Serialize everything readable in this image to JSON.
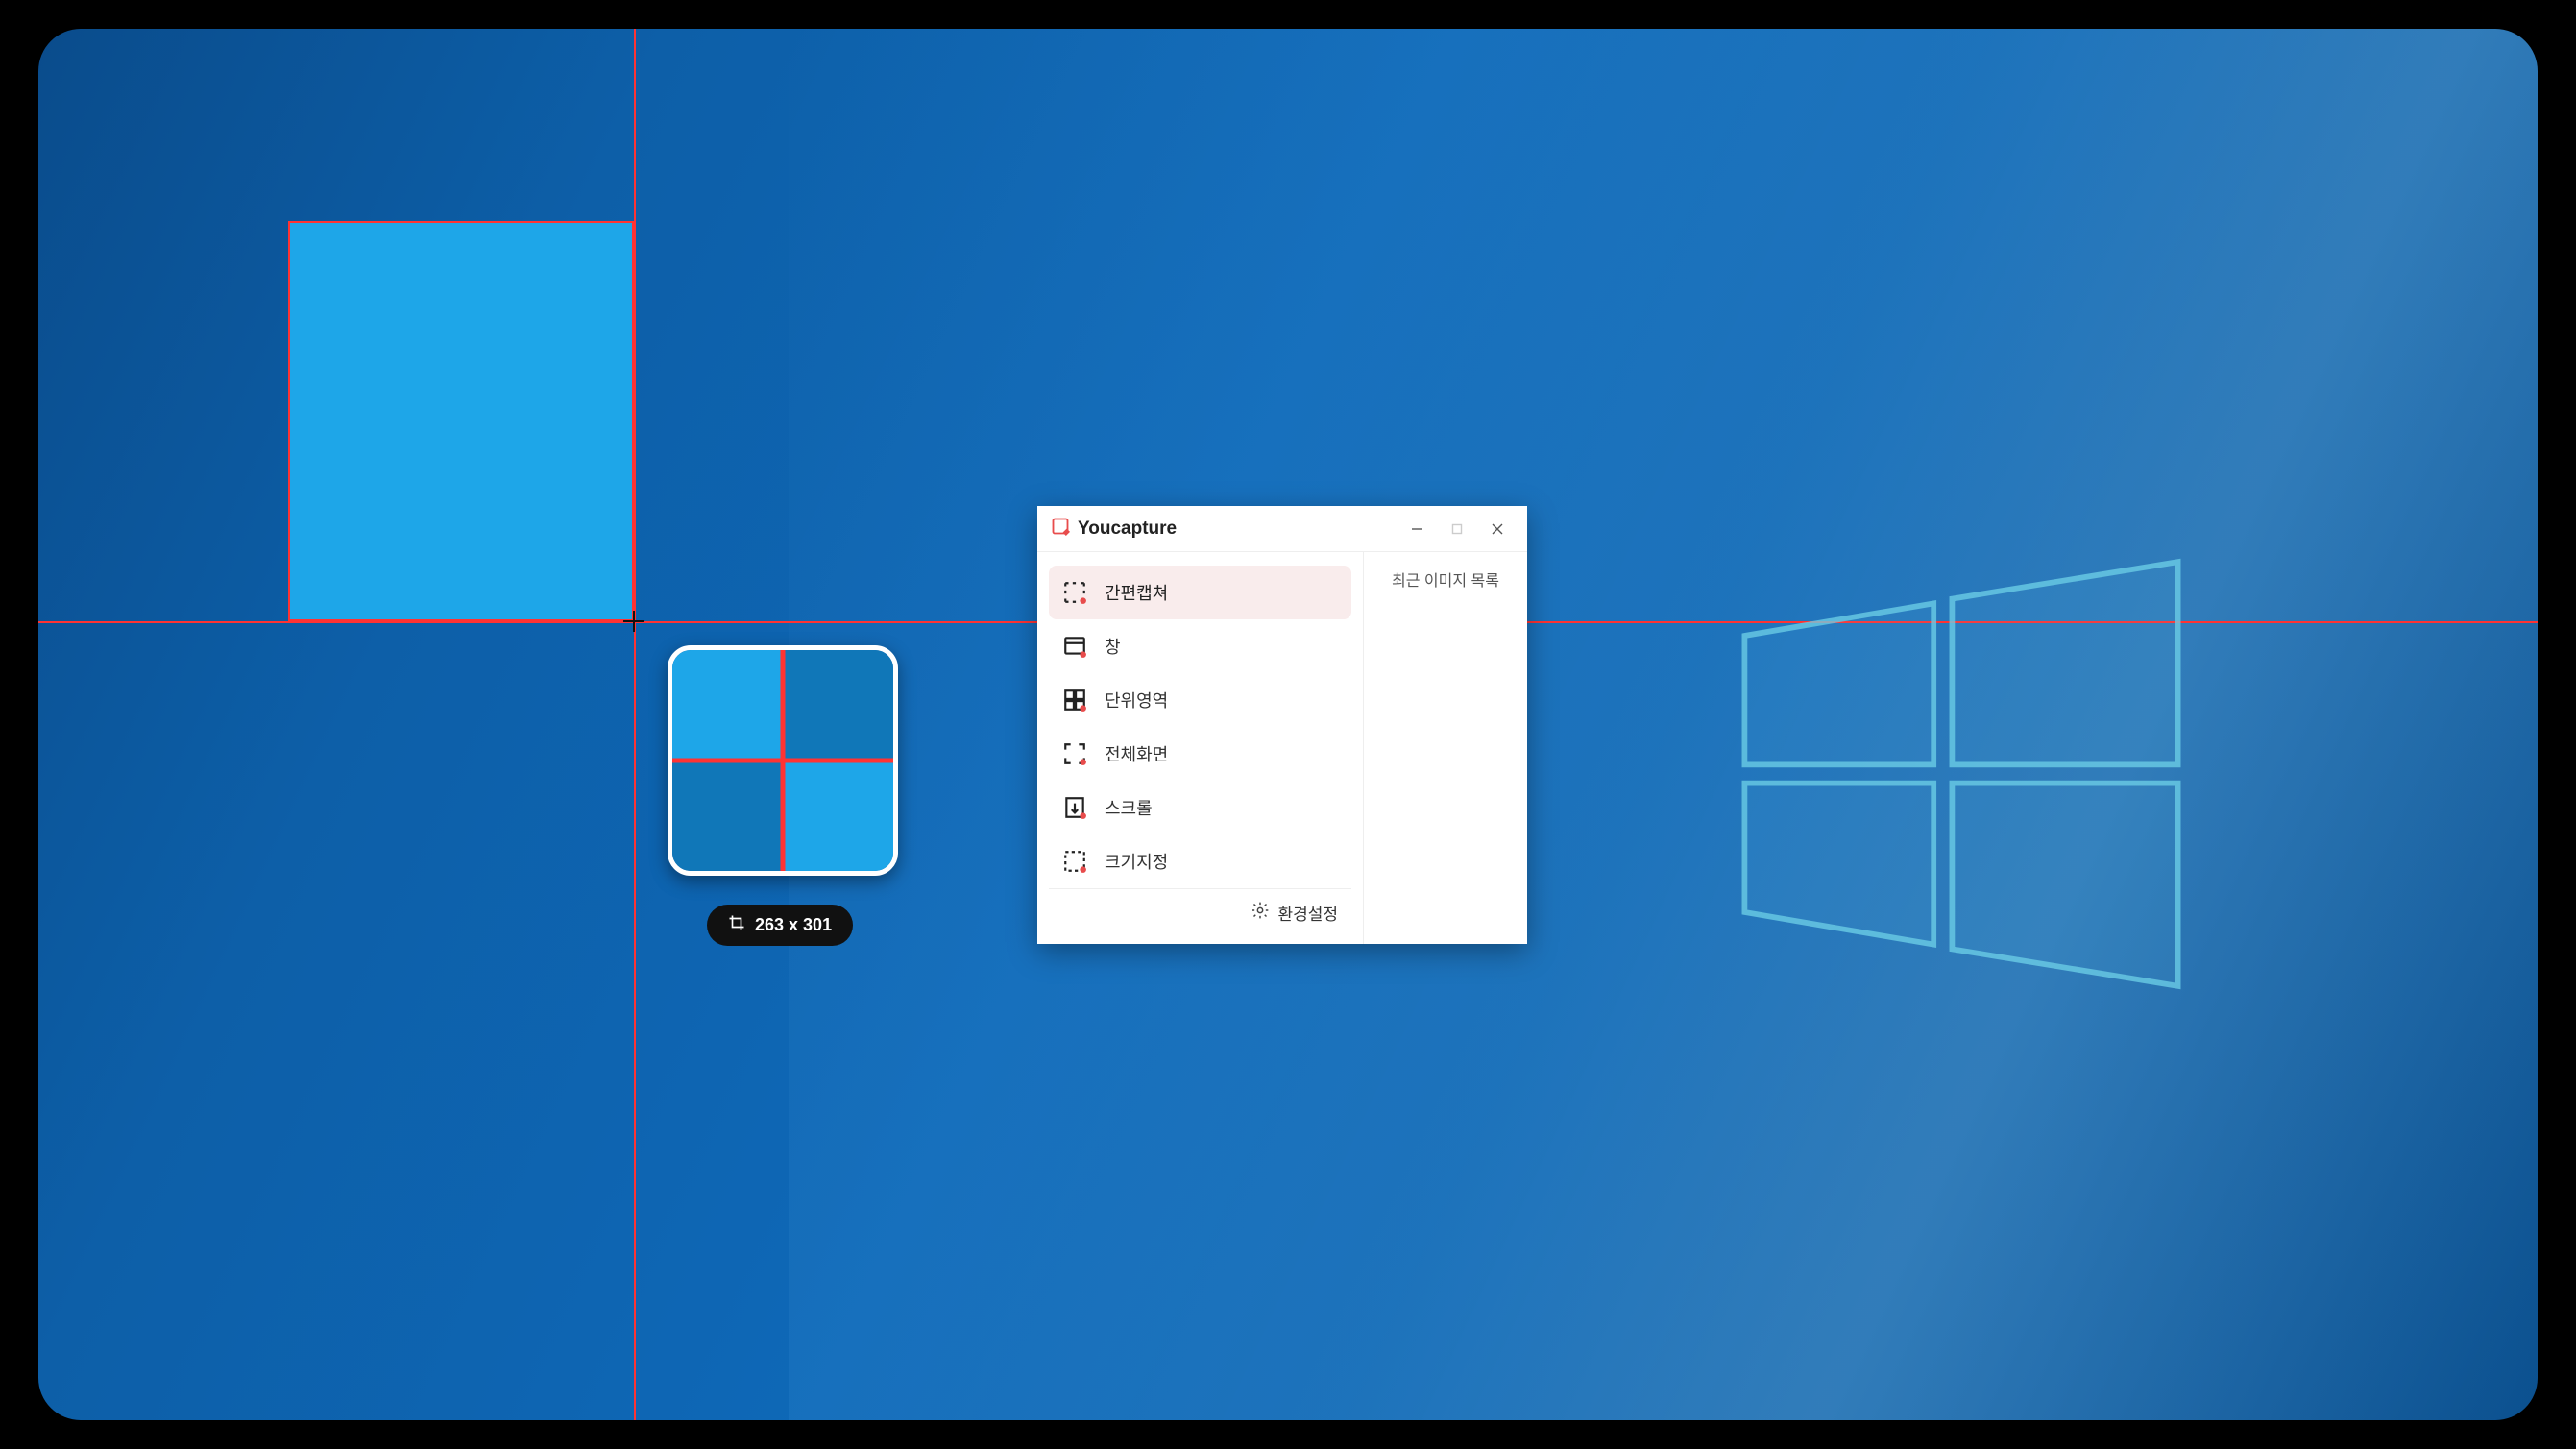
{
  "crosshair": {
    "size_label": "263 x 301"
  },
  "app": {
    "title": "Youcapture",
    "menu": [
      {
        "label": "간편캡쳐",
        "icon": "dashed-selection-icon"
      },
      {
        "label": "창",
        "icon": "window-icon"
      },
      {
        "label": "단위영역",
        "icon": "grid-region-icon"
      },
      {
        "label": "전체화면",
        "icon": "fullscreen-icon"
      },
      {
        "label": "스크롤",
        "icon": "scroll-icon"
      },
      {
        "label": "크기지정",
        "icon": "size-spec-icon"
      }
    ],
    "side_heading": "최근 이미지 목록",
    "settings_label": "환경설정"
  },
  "colors": {
    "accent": "#e84c4c",
    "crosshair": "#ff3333"
  }
}
